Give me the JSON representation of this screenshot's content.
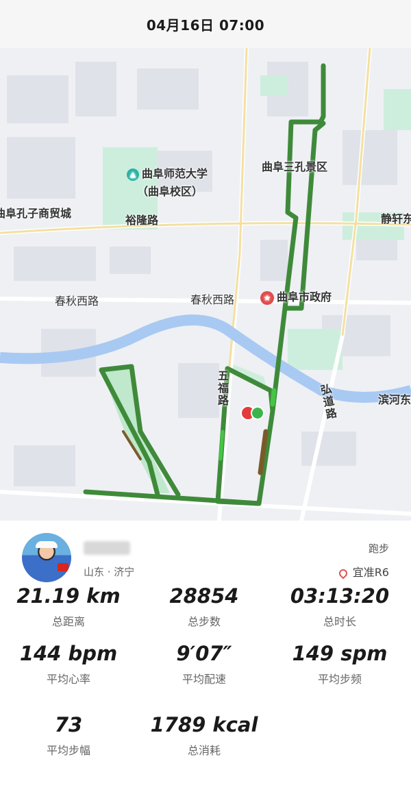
{
  "header": {
    "datetime": "04月16日 07:00"
  },
  "map": {
    "labels": {
      "university": "曲阜师范大学",
      "campus": "（曲阜校区）",
      "scenic": "曲阜三孔景区",
      "mall": "曲阜孔子商贸城",
      "yulong": "裕隆路",
      "jingxuan": "静轩东",
      "chunqiu_w1": "春秋西路",
      "chunqiu_w2": "春秋西路",
      "gov": "曲阜市政府",
      "wufu": "五福路",
      "hongdao": "弘道路",
      "binhe": "滨河东"
    },
    "colors": {
      "track": "#3f8a3a",
      "track_fast": "#45c545",
      "track_slow": "#7b5a2a",
      "water": "#9ec5f0",
      "green": "#bfe8d0"
    }
  },
  "profile": {
    "location": "山东 · 济宁",
    "sport": "跑步",
    "venue": "宜准R6"
  },
  "stats": [
    {
      "value": "21.19 km",
      "label": "总距离"
    },
    {
      "value": "28854",
      "label": "总步数"
    },
    {
      "value": "03:13:20",
      "label": "总时长"
    },
    {
      "value": "144 bpm",
      "label": "平均心率"
    },
    {
      "value": "9′07″",
      "label": "平均配速"
    },
    {
      "value": "149 spm",
      "label": "平均步频"
    },
    {
      "value": "73",
      "label": "平均步幅"
    },
    {
      "value": "1789 kcal",
      "label": "总消耗"
    }
  ]
}
